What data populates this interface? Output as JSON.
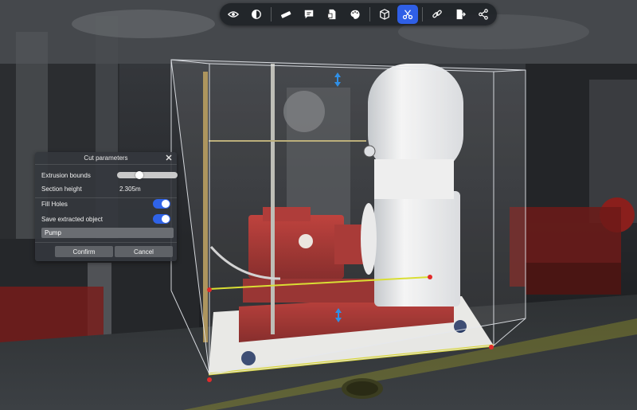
{
  "toolbar": {
    "buttons": [
      {
        "icon": "eye-icon",
        "active": false
      },
      {
        "icon": "contrast-icon",
        "active": false
      },
      {
        "icon": "measure-icon",
        "active": false
      },
      {
        "icon": "comment-icon",
        "active": false
      },
      {
        "icon": "document-icon",
        "active": false
      },
      {
        "icon": "paint-icon",
        "active": false
      },
      {
        "icon": "box-icon",
        "active": false
      },
      {
        "icon": "scissors-icon",
        "active": true
      },
      {
        "icon": "link-icon",
        "active": false
      },
      {
        "icon": "export-icon",
        "active": false
      },
      {
        "icon": "share-icon",
        "active": false
      }
    ],
    "active_color": "#2f5fe6"
  },
  "cut_panel": {
    "title": "Cut parameters",
    "extrusion_label": "Extrusion bounds",
    "extrusion_value": 0.35,
    "section_height_label": "Section height",
    "section_height_value": "2.305m",
    "fill_holes_label": "Fill Holes",
    "fill_holes_on": true,
    "save_label": "Save extracted object",
    "save_on": true,
    "object_name": "Pump",
    "confirm_label": "Confirm",
    "cancel_label": "Cancel",
    "toggle_color": "#2f63e8"
  }
}
